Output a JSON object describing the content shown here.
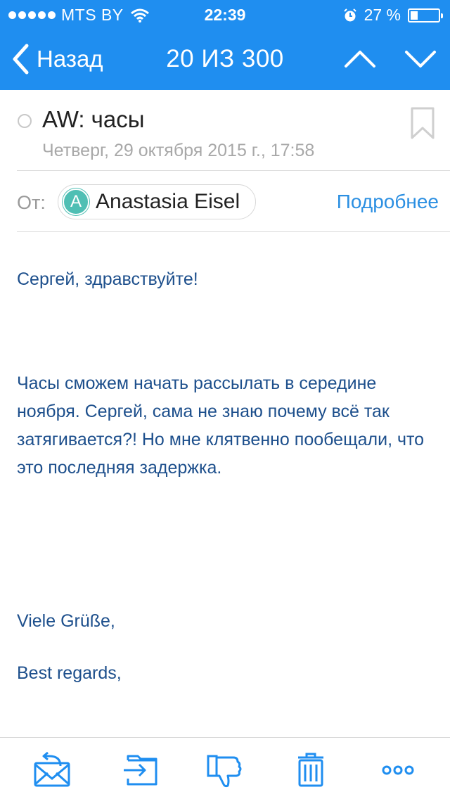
{
  "status_bar": {
    "carrier": "MTS BY",
    "time": "22:39",
    "battery_text": "27 %",
    "battery_level": 0.27,
    "icons": [
      "signal-dots",
      "wifi-icon",
      "alarm-icon",
      "battery-icon"
    ]
  },
  "nav": {
    "back_label": "Назад",
    "title": "20 ИЗ 300",
    "prev_icon": "chevron-up-icon",
    "next_icon": "chevron-down-icon"
  },
  "message": {
    "subject": "AW: часы",
    "date": "Четверг, 29 октября 2015 г., 17:58",
    "from_label": "От:",
    "sender_initial": "A",
    "sender_name": "Anastasia Eisel",
    "details_link": "Подробнее",
    "body": {
      "greeting": "Сергей, здравствуйте!",
      "paragraph": "Часы сможем начать рассылать в середине ноября. Сергей, сама не знаю почему всё так затягивается?! Но мне клятвенно пообещали, что это последняя задержка.",
      "closing1": "Viele Grüße,",
      "closing2": "Best regards,"
    }
  },
  "toolbar": {
    "items": [
      "reply-icon",
      "move-to-folder-icon",
      "spam-thumbs-down-icon",
      "trash-icon",
      "more-icon"
    ]
  },
  "colors": {
    "header": "#1f8ef0",
    "body_text": "#1d4f8c",
    "link": "#2b8fe2",
    "toolbar_icon": "#1f8ef0",
    "avatar": "#4fbfb4"
  }
}
